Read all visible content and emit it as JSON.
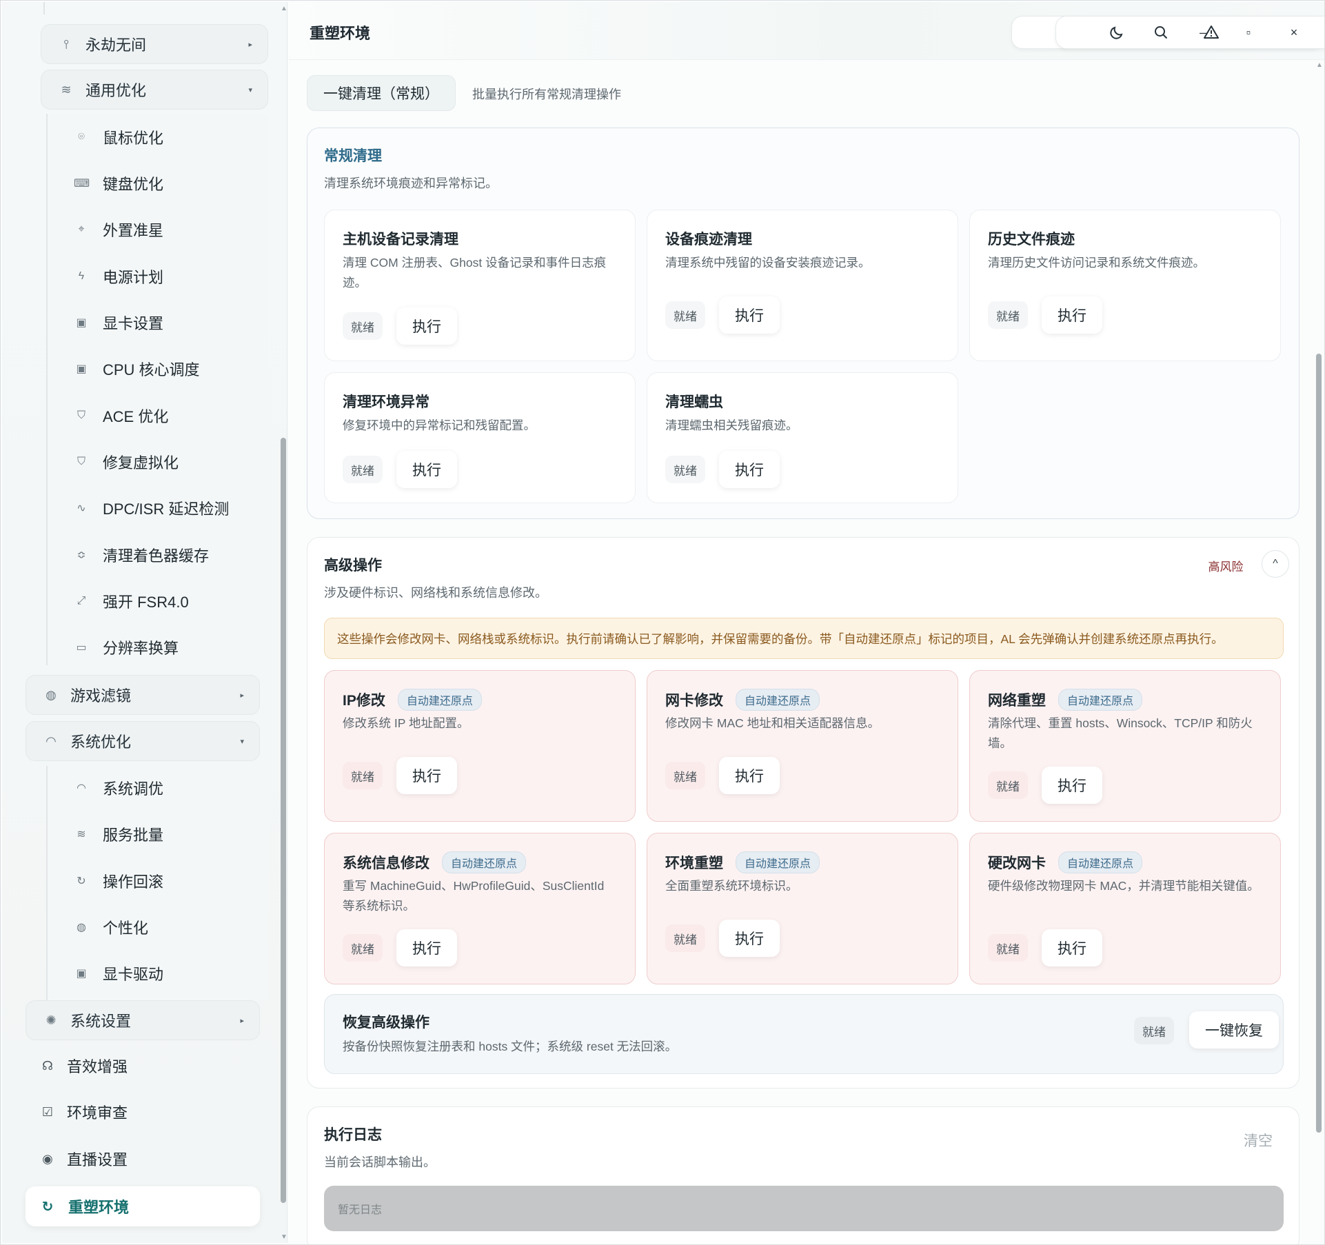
{
  "window": {
    "title": "重塑环境"
  },
  "titlebar": {
    "icons": [
      "heart-icon",
      "warning-icon",
      "moon-icon",
      "search-icon"
    ],
    "controls": {
      "minimize": "–",
      "maximize": "▫",
      "close": "×"
    }
  },
  "sidebar": {
    "groups": {
      "g1": {
        "label": "永劫无间",
        "icon": "sword-icon"
      },
      "g2": {
        "label": "通用优化",
        "icon": "sliders-icon"
      },
      "g3": {
        "label": "游戏滤镜",
        "icon": "palette-icon"
      },
      "g4": {
        "label": "系统优化",
        "icon": "gauge-icon"
      },
      "g5": {
        "label": "系统设置",
        "icon": "sun-gear-icon"
      }
    },
    "general_items": [
      {
        "label": "鼠标优化",
        "icon": "mouse-icon"
      },
      {
        "label": "键盘优化",
        "icon": "keyboard-icon"
      },
      {
        "label": "外置准星",
        "icon": "crosshair-icon"
      },
      {
        "label": "电源计划",
        "icon": "bolt-icon"
      },
      {
        "label": "显卡设置",
        "icon": "chip-icon"
      },
      {
        "label": "CPU 核心调度",
        "icon": "chip-icon"
      },
      {
        "label": "ACE 优化",
        "icon": "shield-icon"
      },
      {
        "label": "修复虚拟化",
        "icon": "shield-icon"
      },
      {
        "label": "DPC/ISR 延迟检测",
        "icon": "pulse-icon"
      },
      {
        "label": "清理着色器缓存",
        "icon": "layers-icon"
      },
      {
        "label": "强开 FSR4.0",
        "icon": "expand-icon"
      },
      {
        "label": "分辨率换算",
        "icon": "monitor-icon"
      }
    ],
    "system_items": [
      {
        "label": "系统调优",
        "icon": "gauge-icon"
      },
      {
        "label": "服务批量",
        "icon": "sliders-icon"
      },
      {
        "label": "操作回滚",
        "icon": "refresh-icon"
      },
      {
        "label": "个性化",
        "icon": "palette-icon"
      },
      {
        "label": "显卡驱动",
        "icon": "chip-icon"
      }
    ],
    "top_items": [
      {
        "label": "音效增强",
        "icon": "headphones-icon"
      },
      {
        "label": "环境审查",
        "icon": "checkbox-icon"
      },
      {
        "label": "直播设置",
        "icon": "broadcast-icon"
      }
    ],
    "active": {
      "label": "重塑环境",
      "icon": "refresh-icon"
    }
  },
  "main": {
    "top_tab": "一键清理（常规）",
    "top_desc": "批量执行所有常规清理操作",
    "general": {
      "title": "常规清理",
      "desc": "清理系统环境痕迹和异常标记。",
      "cards": [
        {
          "title": "主机设备记录清理",
          "desc": "清理 COM 注册表、Ghost 设备记录和事件日志痕迹。",
          "status": "就绪",
          "button": "执行"
        },
        {
          "title": "设备痕迹清理",
          "desc": "清理系统中残留的设备安装痕迹记录。",
          "status": "就绪",
          "button": "执行"
        },
        {
          "title": "历史文件痕迹",
          "desc": "清理历史文件访问记录和系统文件痕迹。",
          "status": "就绪",
          "button": "执行"
        },
        {
          "title": "清理环境异常",
          "desc": "修复环境中的异常标记和残留配置。",
          "status": "就绪",
          "button": "执行"
        },
        {
          "title": "清理蠕虫",
          "desc": "清理蠕虫相关残留痕迹。",
          "status": "就绪",
          "button": "执行"
        }
      ]
    },
    "advanced": {
      "title": "高级操作",
      "desc": "涉及硬件标识、网络栈和系统信息修改。",
      "risk_tag": "高风险",
      "collapse": "^",
      "warning": "这些操作会修改网卡、网络栈或系统标识。执行前请确认已了解影响，并保留需要的备份。带「自动建还原点」标记的项目，AL 会先弹确认并创建系统还原点再执行。",
      "cards": [
        {
          "title": "IP修改",
          "badge": "自动建还原点",
          "desc": "修改系统 IP 地址配置。",
          "status": "就绪",
          "button": "执行"
        },
        {
          "title": "网卡修改",
          "badge": "自动建还原点",
          "desc": "修改网卡 MAC 地址和相关适配器信息。",
          "status": "就绪",
          "button": "执行"
        },
        {
          "title": "网络重塑",
          "badge": "自动建还原点",
          "desc": "清除代理、重置 hosts、Winsock、TCP/IP 和防火墙。",
          "status": "就绪",
          "button": "执行"
        },
        {
          "title": "系统信息修改",
          "badge": "自动建还原点",
          "desc": "重写 MachineGuid、HwProfileGuid、SusClientId 等系统标识。",
          "status": "就绪",
          "button": "执行"
        },
        {
          "title": "环境重塑",
          "badge": "自动建还原点",
          "desc": "全面重塑系统环境标识。",
          "status": "就绪",
          "button": "执行"
        },
        {
          "title": "硬改网卡",
          "badge": "自动建还原点",
          "desc": "硬件级修改物理网卡 MAC，并清理节能相关键值。",
          "status": "就绪",
          "button": "执行"
        }
      ],
      "restore": {
        "title": "恢复高级操作",
        "desc": "按备份快照恢复注册表和 hosts 文件；系统级 reset 无法回滚。",
        "status": "就绪",
        "button": "一键恢复"
      }
    },
    "log": {
      "title": "执行日志",
      "desc": "当前会话脚本输出。",
      "clear": "清空",
      "empty": "暂无日志"
    }
  }
}
